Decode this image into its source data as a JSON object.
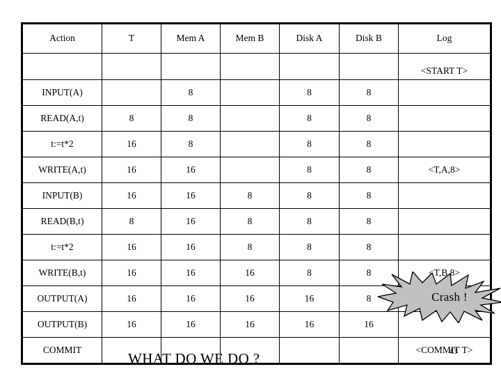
{
  "table": {
    "columns": [
      "Action",
      "T",
      "Mem A",
      "Mem B",
      "Disk A",
      "Disk B",
      "Log"
    ],
    "rows": [
      {
        "action": "",
        "t": "",
        "mem_a": "",
        "mem_b": "",
        "disk_a": "",
        "disk_b": "",
        "log": "<START T>"
      },
      {
        "action": "INPUT(A)",
        "t": "",
        "mem_a": "8",
        "mem_b": "",
        "disk_a": "8",
        "disk_b": "8",
        "log": ""
      },
      {
        "action": "READ(A,t)",
        "t": "8",
        "mem_a": "8",
        "mem_b": "",
        "disk_a": "8",
        "disk_b": "8",
        "log": ""
      },
      {
        "action": "t:=t*2",
        "t": "16",
        "mem_a": "8",
        "mem_b": "",
        "disk_a": "8",
        "disk_b": "8",
        "log": ""
      },
      {
        "action": "WRITE(A,t)",
        "t": "16",
        "mem_a": "16",
        "mem_b": "",
        "disk_a": "8",
        "disk_b": "8",
        "log": "<T,A,8>"
      },
      {
        "action": "INPUT(B)",
        "t": "16",
        "mem_a": "16",
        "mem_b": "8",
        "disk_a": "8",
        "disk_b": "8",
        "log": ""
      },
      {
        "action": "READ(B,t)",
        "t": "8",
        "mem_a": "16",
        "mem_b": "8",
        "disk_a": "8",
        "disk_b": "8",
        "log": ""
      },
      {
        "action": "t:=t*2",
        "t": "16",
        "mem_a": "16",
        "mem_b": "8",
        "disk_a": "8",
        "disk_b": "8",
        "log": ""
      },
      {
        "action": "WRITE(B,t)",
        "t": "16",
        "mem_a": "16",
        "mem_b": "16",
        "disk_a": "8",
        "disk_b": "8",
        "log": "<T,B,8>"
      },
      {
        "action": "OUTPUT(A)",
        "t": "16",
        "mem_a": "16",
        "mem_b": "16",
        "disk_a": "16",
        "disk_b": "8",
        "log": ""
      },
      {
        "action": "OUTPUT(B)",
        "t": "16",
        "mem_a": "16",
        "mem_b": "16",
        "disk_a": "16",
        "disk_b": "16",
        "log": ""
      },
      {
        "action": "COMMIT",
        "t": "",
        "mem_a": "",
        "mem_b": "",
        "disk_a": "",
        "disk_b": "",
        "log": "<COMMIT T>"
      }
    ]
  },
  "annotation": {
    "crash_label": "Crash !",
    "crash_fill": "#c0c0c0",
    "crash_stroke": "#000000"
  },
  "caption": "WHAT DO WE DO ?",
  "page_number": "43"
}
